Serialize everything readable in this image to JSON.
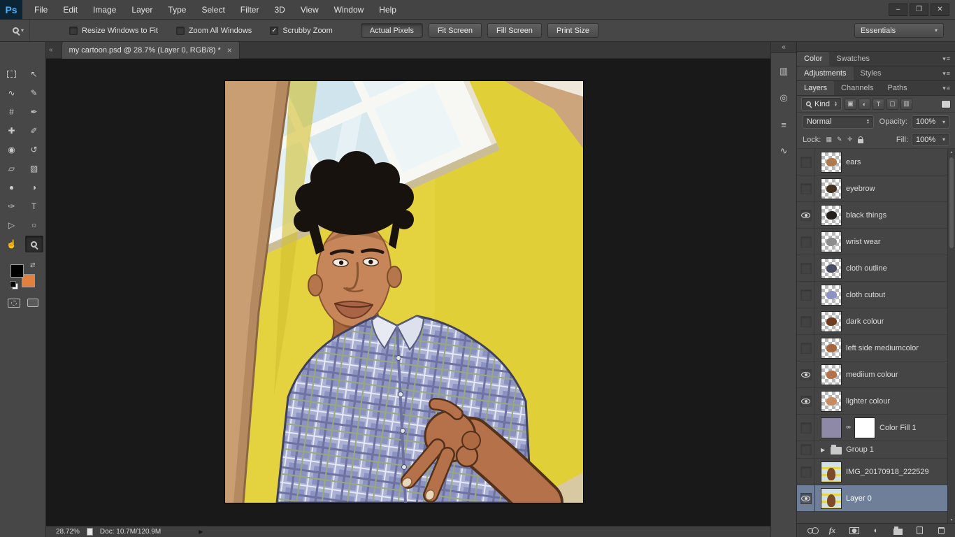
{
  "app": {
    "logo": "Ps"
  },
  "menubar": {
    "items": [
      "File",
      "Edit",
      "Image",
      "Layer",
      "Type",
      "Select",
      "Filter",
      "3D",
      "View",
      "Window",
      "Help"
    ]
  },
  "window_controls": [
    {
      "name": "minimize-button",
      "glyph": "–"
    },
    {
      "name": "restore-button",
      "glyph": "❐"
    },
    {
      "name": "close-button",
      "glyph": "✕"
    }
  ],
  "options": {
    "dropdown_caret": "▾",
    "check_glyph": "✓",
    "checkboxes": [
      {
        "label": "Resize Windows to Fit",
        "checked": false
      },
      {
        "label": "Zoom All Windows",
        "checked": false
      },
      {
        "label": "Scrubby Zoom",
        "checked": true
      }
    ],
    "buttons": [
      {
        "label": "Actual Pixels",
        "pressed": true
      },
      {
        "label": "Fit Screen",
        "pressed": false
      },
      {
        "label": "Fill Screen",
        "pressed": false
      },
      {
        "label": "Print Size",
        "pressed": false
      }
    ],
    "workspace": "Essentials"
  },
  "toolbar": {
    "foreground_color": "#000000",
    "background_color": "#e0813f",
    "swap_glyph": "⇄",
    "tools": [
      {
        "name": "rectangular-marquee-tool",
        "css": "marquee"
      },
      {
        "name": "move-tool",
        "glyph": "↖"
      },
      {
        "name": "lasso-tool",
        "glyph": "∿"
      },
      {
        "name": "quick-selection-tool",
        "glyph": "✎"
      },
      {
        "name": "crop-tool",
        "glyph": "#"
      },
      {
        "name": "eyedropper-tool",
        "glyph": "✒"
      },
      {
        "name": "spot-healing-brush-tool",
        "glyph": "✚"
      },
      {
        "name": "brush-tool",
        "glyph": "✐"
      },
      {
        "name": "clone-stamp-tool",
        "glyph": "◉"
      },
      {
        "name": "history-brush-tool",
        "glyph": "↺"
      },
      {
        "name": "eraser-tool",
        "glyph": "▱"
      },
      {
        "name": "gradient-tool",
        "glyph": "▨"
      },
      {
        "name": "blur-tool",
        "glyph": "●"
      },
      {
        "name": "dodge-tool",
        "glyph": "◑"
      },
      {
        "name": "pen-tool",
        "glyph": "✑"
      },
      {
        "name": "type-tool",
        "glyph": "T"
      },
      {
        "name": "path-selection-tool",
        "glyph": "▷"
      },
      {
        "name": "ellipse-tool",
        "glyph": "○"
      },
      {
        "name": "hand-tool",
        "glyph": "☝"
      },
      {
        "name": "zoom-tool",
        "css": "mag",
        "active": true
      }
    ]
  },
  "document": {
    "tab_title": "my cartoon.psd @ 28.7% (Layer 0, RGB/8) *",
    "close_glyph": "×",
    "tab_scroll_glyph": "«"
  },
  "statusbar": {
    "zoom": "28.72%",
    "doc": "Doc: 10.7M/120.9M",
    "menu_arrow": "▶"
  },
  "panel_strip": {
    "collapse_glyph": "«",
    "icons": [
      {
        "name": "histogram-panel-icon",
        "glyph": "▥"
      },
      {
        "name": "navigator-panel-icon",
        "glyph": "◎"
      },
      {
        "name": "properties-panel-icon",
        "glyph": "≡"
      },
      {
        "name": "curves-panel-icon",
        "glyph": "∿"
      }
    ]
  },
  "right": {
    "panel_menu_glyph": "▾≡",
    "tab_groups": [
      {
        "name": "color-swatches",
        "tabs": [
          {
            "label": "Color",
            "active": true
          },
          {
            "label": "Swatches",
            "active": false
          }
        ]
      },
      {
        "name": "adjustments-styles",
        "tabs": [
          {
            "label": "Adjustments",
            "active": true
          },
          {
            "label": "Styles",
            "active": false
          }
        ]
      },
      {
        "name": "layers-channels-paths",
        "tabs": [
          {
            "label": "Layers",
            "active": true
          },
          {
            "label": "Channels",
            "active": false
          },
          {
            "label": "Paths",
            "active": false
          }
        ]
      }
    ],
    "layers_panel": {
      "filter_label": "Kind",
      "filter_icons": [
        {
          "name": "filter-pixel-layers-icon",
          "glyph": "▣"
        },
        {
          "name": "filter-adjustment-layers-icon",
          "glyph": "◐"
        },
        {
          "name": "filter-type-layers-icon",
          "glyph": "T"
        },
        {
          "name": "filter-shape-layers-icon",
          "glyph": "▢"
        },
        {
          "name": "filter-smart-objects-icon",
          "glyph": "▥"
        }
      ],
      "blend_mode": "Normal",
      "opacity_label": "Opacity:",
      "opacity_value": "100%",
      "lock_label": "Lock:",
      "lock_icons": [
        {
          "name": "lock-transparency-icon",
          "glyph": "▦"
        },
        {
          "name": "lock-pixels-icon",
          "glyph": "✎"
        },
        {
          "name": "lock-position-icon",
          "glyph": "✛"
        },
        {
          "name": "lock-all-icon",
          "css": "lock"
        }
      ],
      "fill_label": "Fill:",
      "fill_value": "100%",
      "disclosure_glyph": "▶",
      "scroll_up_glyph": "▴",
      "scroll_down_glyph": "▾",
      "layers": [
        {
          "name": "ears",
          "kind": "pixel",
          "visible": false,
          "blob": "#b07a4e"
        },
        {
          "name": "eyebrow",
          "kind": "pixel",
          "visible": false,
          "blob": "#45311f"
        },
        {
          "name": "black things",
          "kind": "pixel",
          "visible": true,
          "blob": "#23201d"
        },
        {
          "name": "wrist wear",
          "kind": "pixel",
          "visible": false,
          "blob": "#8d8d8d"
        },
        {
          "name": "cloth outline",
          "kind": "pixel",
          "visible": false,
          "blob": "#4a4d66"
        },
        {
          "name": "cloth cutout",
          "kind": "pixel",
          "visible": false,
          "blob": "#8c92c1"
        },
        {
          "name": "dark colour",
          "kind": "pixel",
          "visible": false,
          "blob": "#6e3d20"
        },
        {
          "name": "left side mediumcolor",
          "kind": "pixel",
          "visible": false,
          "blob": "#a5683e"
        },
        {
          "name": "mediium colour",
          "kind": "pixel",
          "visible": true,
          "blob": "#b5714a"
        },
        {
          "name": "lighter colour",
          "kind": "pixel",
          "visible": true,
          "blob": "#c98a5e"
        },
        {
          "name": "Color Fill 1",
          "kind": "fill",
          "visible": false,
          "fill_color": "#8e89a6"
        },
        {
          "name": "Group 1",
          "kind": "group",
          "visible": false
        },
        {
          "name": "IMG_20170918_222529",
          "kind": "photo",
          "visible": false
        },
        {
          "name": "Layer 0",
          "kind": "photo",
          "visible": true,
          "selected": true
        }
      ],
      "bottom_icons": [
        {
          "name": "link-layers-icon",
          "css": "chain"
        },
        {
          "name": "layer-style-icon",
          "glyph": "fx"
        },
        {
          "name": "add-layer-mask-icon",
          "css": "maskicon"
        },
        {
          "name": "new-adjustment-layer-icon",
          "glyph": "◐"
        },
        {
          "name": "new-group-icon",
          "css": "foldericon"
        },
        {
          "name": "new-layer-icon",
          "css": "pageicon"
        },
        {
          "name": "delete-layer-icon",
          "css": "trashicon"
        }
      ]
    }
  }
}
